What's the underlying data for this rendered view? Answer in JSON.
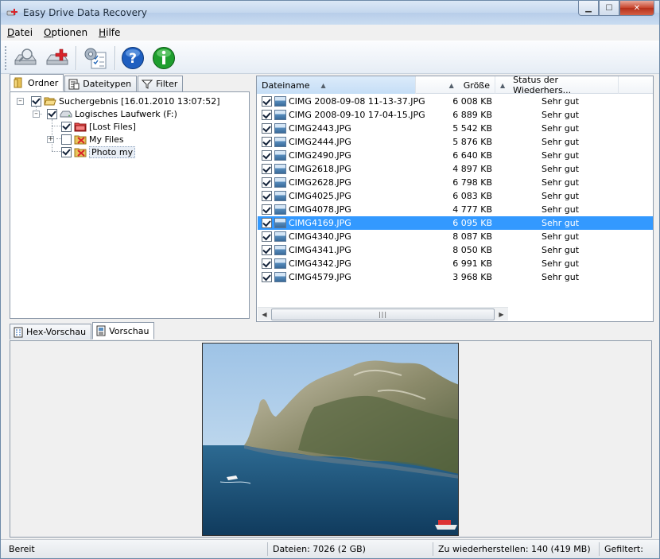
{
  "window": {
    "title": "Easy Drive Data Recovery",
    "min": "▁",
    "max": "☐",
    "close": "✕"
  },
  "menu": [
    {
      "label": "Datei",
      "ul": "D",
      "rest": "atei"
    },
    {
      "label": "Optionen",
      "ul": "O",
      "rest": "ptionen"
    },
    {
      "label": "Hilfe",
      "ul": "H",
      "rest": "ilfe"
    }
  ],
  "left_tabs": [
    "Ordner",
    "Dateitypen",
    "Filter"
  ],
  "tree": {
    "root": "Suchergebnis [16.01.2010 13:07:52]",
    "drive": "Logisches Laufwerk (F:)",
    "folders": [
      "[Lost Files]",
      "My Files",
      "Photo my"
    ]
  },
  "columns": {
    "name": "Dateiname",
    "size": "Größe",
    "status": "Status der Wiederhers..."
  },
  "files": [
    {
      "name": "CIMG 2008-09-08 11-13-37.JPG",
      "size": "6 008 KB",
      "status": "Sehr gut"
    },
    {
      "name": "CIMG 2008-09-10 17-04-15.JPG",
      "size": "6 889 KB",
      "status": "Sehr gut"
    },
    {
      "name": "CIMG2443.JPG",
      "size": "5 542 KB",
      "status": "Sehr gut"
    },
    {
      "name": "CIMG2444.JPG",
      "size": "5 876 KB",
      "status": "Sehr gut"
    },
    {
      "name": "CIMG2490.JPG",
      "size": "6 640 KB",
      "status": "Sehr gut"
    },
    {
      "name": "CIMG2618.JPG",
      "size": "4 897 KB",
      "status": "Sehr gut"
    },
    {
      "name": "CIMG2628.JPG",
      "size": "6 798 KB",
      "status": "Sehr gut"
    },
    {
      "name": "CIMG4025.JPG",
      "size": "6 083 KB",
      "status": "Sehr gut"
    },
    {
      "name": "CIMG4078.JPG",
      "size": "4 777 KB",
      "status": "Sehr gut"
    },
    {
      "name": "CIMG4169.JPG",
      "size": "6 095 KB",
      "status": "Sehr gut"
    },
    {
      "name": "CIMG4340.JPG",
      "size": "8 087 KB",
      "status": "Sehr gut"
    },
    {
      "name": "CIMG4341.JPG",
      "size": "8 050 KB",
      "status": "Sehr gut"
    },
    {
      "name": "CIMG4342.JPG",
      "size": "6 991 KB",
      "status": "Sehr gut"
    },
    {
      "name": "CIMG4579.JPG",
      "size": "3 968 KB",
      "status": "Sehr gut"
    }
  ],
  "selected_file": "CIMG4169.JPG",
  "bottom_tabs": [
    "Hex-Vorschau",
    "Vorschau"
  ],
  "status": {
    "state": "Bereit",
    "files": "Dateien: 7026 (2 GB)",
    "to_recover": "Zu wiederherstellen: 140 (419 MB)",
    "filtered": "Gefiltert:"
  },
  "colors": {
    "selection": "#3399ff",
    "help_blue": "#1f5fc0",
    "info_green": "#1e9e2e"
  }
}
